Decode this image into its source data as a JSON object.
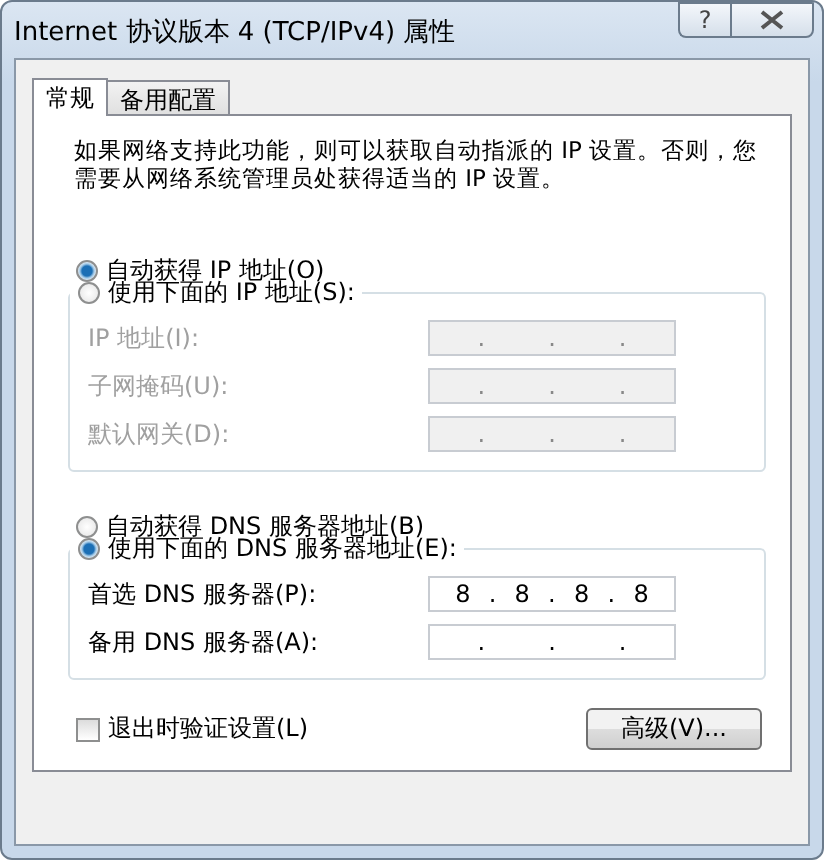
{
  "window": {
    "title": "Internet 协议版本 4 (TCP/IPv4) 属性",
    "help_button": "?"
  },
  "tabs": [
    {
      "label": "常规",
      "selected": true
    },
    {
      "label": "备用配置",
      "selected": false
    }
  ],
  "intro": "如果网络支持此功能，则可以获取自动指派的 IP 设置。否则，您需要从网络系统管理员处获得适当的 IP 设置。",
  "sections": [
    {
      "auto_radio": {
        "label": "自动获得 IP 地址(O)",
        "selected": true
      },
      "manual_radio": {
        "label": "使用下面的 IP 地址(S):",
        "selected": false
      },
      "fields": [
        {
          "label": "IP 地址(I):",
          "segments": [
            ".",
            ".",
            "."
          ]
        },
        {
          "label": "子网掩码(U):",
          "segments": [
            ".",
            ".",
            "."
          ]
        },
        {
          "label": "默认网关(D):",
          "segments": [
            ".",
            ".",
            "."
          ]
        }
      ]
    },
    {
      "auto_radio": {
        "label": "自动获得 DNS 服务器地址(B)",
        "selected": false
      },
      "manual_radio": {
        "label": "使用下面的 DNS 服务器地址(E):",
        "selected": true
      },
      "fields": [
        {
          "label": "首选 DNS 服务器(P):",
          "segments": [
            "8",
            ".",
            "8",
            ".",
            "8",
            ".",
            "8"
          ]
        },
        {
          "label": "备用 DNS 服务器(A):",
          "segments": [
            ".",
            ".",
            "."
          ]
        }
      ]
    }
  ],
  "validate_checkbox": {
    "label": "退出时验证设置(L)",
    "checked": false
  },
  "advanced_button": "高级(V)..."
}
